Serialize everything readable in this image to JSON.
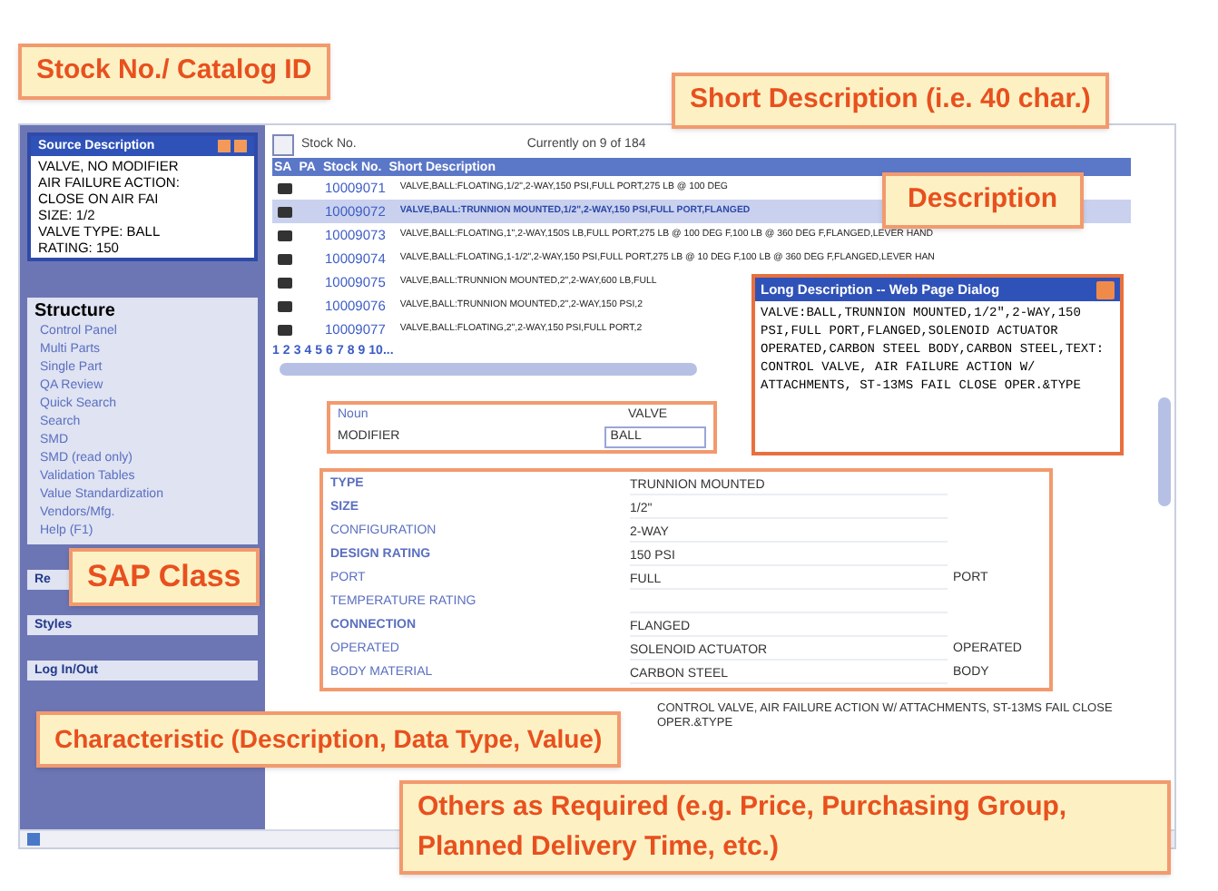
{
  "callouts": [
    {
      "kind": "stock",
      "text": "Stock No./ Catalog ID"
    },
    {
      "kind": "short",
      "text": "Short Description (i.e. 40 char.)"
    },
    {
      "kind": "desc",
      "text": "Description"
    },
    {
      "kind": "sap",
      "text": "SAP Class"
    },
    {
      "kind": "char",
      "text": "Characteristic (Description, Data Type, Value)"
    },
    {
      "kind": "others",
      "text": "Others as Required (e.g. Price, Purchasing Group, Planned Delivery Time, etc.)"
    }
  ],
  "source_panel": {
    "title": "Source Description",
    "lines": [
      "VALVE, NO MODIFIER",
      "AIR FAILURE ACTION:",
      "CLOSE ON AIR FAI",
      "SIZE: 1/2",
      "VALVE TYPE: BALL",
      "RATING: 150"
    ]
  },
  "structure": {
    "title": "Structure",
    "items": [
      "Control Panel",
      "Multi Parts",
      "Single Part",
      "QA Review",
      "Quick Search",
      "Search",
      "SMD",
      "SMD (read only)",
      "Validation Tables",
      "Value Standardization",
      "Vendors/Mfg.",
      "Help (F1)"
    ]
  },
  "sections": [
    "Re",
    "Styles",
    "Log In/Out"
  ],
  "list": {
    "search_label": "Stock No.",
    "position": "Currently on 9 of 184",
    "columns": [
      "SA",
      "PA",
      "Stock No.",
      "Short Description"
    ],
    "rows": [
      {
        "stock": "10009071",
        "description": "VALVE,BALL:FLOATING,1/2\",2-WAY,150 PSI,FULL PORT,275 LB @ 100 DEG",
        "selected": false
      },
      {
        "stock": "10009072",
        "description": "VALVE,BALL:TRUNNION MOUNTED,1/2\",2-WAY,150 PSI,FULL PORT,FLANGED",
        "selected": true
      },
      {
        "stock": "10009073",
        "description": "VALVE,BALL:FLOATING,1\",2-WAY,150S LB,FULL PORT,275 LB @ 100 DEG F,100 LB @ 360 DEG F,FLANGED,LEVER HAND",
        "selected": false
      },
      {
        "stock": "10009074",
        "description": "VALVE,BALL:FLOATING,1-1/2\",2-WAY,150 PSI,FULL PORT,275 LB @ 10 DEG F,100 LB @ 360 DEG F,FLANGED,LEVER HAN",
        "selected": false
      },
      {
        "stock": "10009075",
        "description": "VALVE,BALL:TRUNNION MOUNTED,2\",2-WAY,600 LB,FULL",
        "selected": false
      },
      {
        "stock": "10009076",
        "description": "VALVE,BALL:TRUNNION MOUNTED,2\",2-WAY,150 PSI,2",
        "selected": false
      },
      {
        "stock": "10009077",
        "description": "VALVE,BALL:FLOATING,2\",2-WAY,150 PSI,FULL PORT,2",
        "selected": false
      }
    ],
    "pages": [
      "1",
      "2",
      "3",
      "4",
      "5",
      "6",
      "7",
      "8",
      "9",
      "10..."
    ]
  },
  "dialog": {
    "title": "Long Description -- Web Page Dialog",
    "text": "VALVE:BALL,TRUNNION MOUNTED,1/2\",2-WAY,150 PSI,FULL PORT,FLANGED,SOLENOID ACTUATOR OPERATED,CARBON STEEL BODY,CARBON STEEL,TEXT: CONTROL VALVE, AIR FAILURE ACTION W/ ATTACHMENTS, ST-13MS FAIL CLOSE OPER.&TYPE"
  },
  "header_fields": {
    "noun_label": "Noun",
    "noun_value": "VALVE",
    "modifier_label": "MODIFIER",
    "modifier_value": "BALL"
  },
  "characteristics": [
    {
      "label": "TYPE",
      "required": true,
      "value": "TRUNNION MOUNTED"
    },
    {
      "label": "SIZE",
      "required": true,
      "value": "1/2\""
    },
    {
      "label": "CONFIGURATION",
      "required": false,
      "value": "2-WAY"
    },
    {
      "label": "DESIGN RATING",
      "required": true,
      "value": "150 PSI"
    },
    {
      "label": "PORT",
      "required": false,
      "value": "FULL",
      "extra": "PORT"
    },
    {
      "label": "TEMPERATURE RATING",
      "required": false
    },
    {
      "label": "CONNECTION",
      "required": true,
      "value": "FLANGED"
    },
    {
      "label": "OPERATED",
      "required": false,
      "value": "SOLENOID ACTUATOR",
      "extra": "OPERATED"
    },
    {
      "label": "BODY MATERIAL",
      "required": false,
      "value": "CARBON STEEL",
      "extra": "BODY"
    }
  ],
  "long_text": "CONTROL VALVE, AIR FAILURE ACTION W/ ATTACHMENTS, ST-13MS FAIL CLOSE OPER.&TYPE"
}
